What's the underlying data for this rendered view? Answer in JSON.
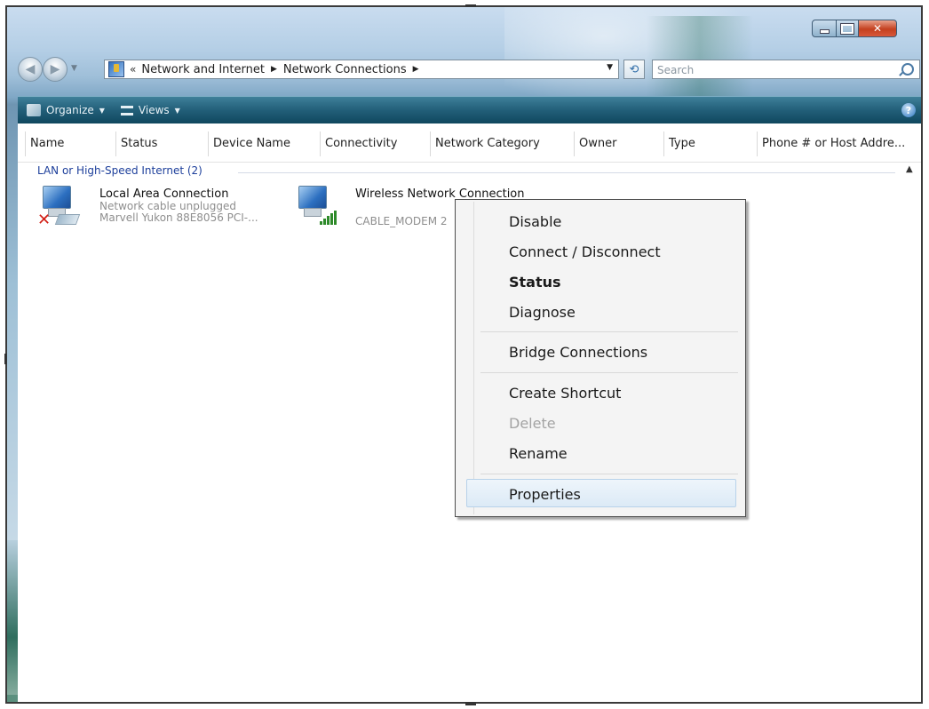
{
  "address": {
    "overflow": "«",
    "crumbs": [
      "Network and Internet",
      "Network Connections"
    ]
  },
  "search": {
    "placeholder": "Search"
  },
  "command_bar": {
    "organize_label": "Organize",
    "views_label": "Views"
  },
  "columns": [
    "Name",
    "Status",
    "Device Name",
    "Connectivity",
    "Network Category",
    "Owner",
    "Type",
    "Phone # or Host Addre..."
  ],
  "group": {
    "title": "LAN or High-Speed Internet (2)"
  },
  "connections": [
    {
      "name": "Local Area Connection",
      "status": "Network cable unplugged",
      "device": "Marvell Yukon 88E8056 PCI-..."
    },
    {
      "name": "Wireless Network Connection",
      "status": "CABLE_MODEM 2"
    }
  ],
  "context_menu": {
    "items": [
      "Disable",
      "Connect / Disconnect",
      "Status",
      "Diagnose",
      "Bridge Connections",
      "Create Shortcut",
      "Delete",
      "Rename",
      "Properties"
    ],
    "default_item": "Status",
    "disabled_item": "Delete",
    "hovered_item": "Properties"
  },
  "colors": {
    "command_bar": "#225f79",
    "group_header": "#1d3f9b",
    "close_button": "#c4401f"
  }
}
